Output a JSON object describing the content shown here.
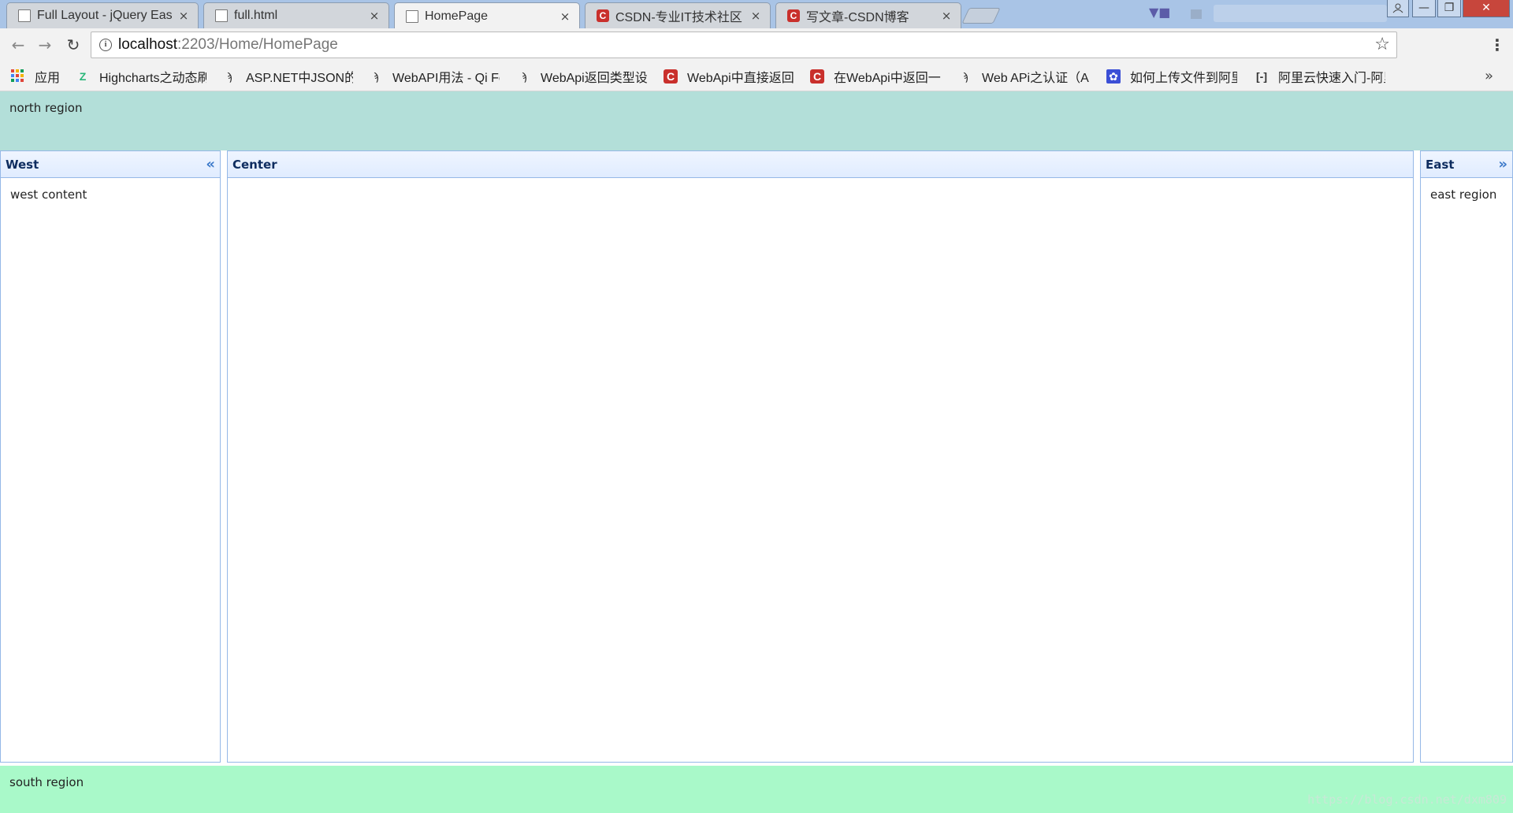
{
  "browser": {
    "tabs": [
      {
        "title": "Full Layout - jQuery Eas",
        "icon": "document-icon",
        "close": "×"
      },
      {
        "title": "full.html",
        "icon": "document-icon",
        "close": "×"
      },
      {
        "title": "HomePage",
        "icon": "document-icon",
        "close": "×"
      },
      {
        "title": "CSDN-专业IT技术社区",
        "icon": "csdn-icon",
        "close": "×"
      },
      {
        "title": "写文章-CSDN博客",
        "icon": "csdn-icon",
        "close": "×"
      }
    ],
    "window_controls": {
      "minimize": "—",
      "restore": "❐",
      "close": "✕"
    },
    "nav": {
      "back": "←",
      "forward": "→",
      "reload": "↻"
    },
    "address": {
      "host": "localhost",
      "path": ":2203/Home/HomePage",
      "info": "i",
      "star": "☆"
    },
    "menu": "⋮",
    "bookmarks": [
      {
        "label": "应用",
        "icon": "apps-icon"
      },
      {
        "label": "Highcharts之动态刷",
        "icon": "highcharts-icon"
      },
      {
        "label": "ASP.NET中JSON的序",
        "icon": "cnblogs-icon"
      },
      {
        "label": "WebAPI用法 - Qi Fe",
        "icon": "cnblogs-icon"
      },
      {
        "label": "WebApi返回类型设",
        "icon": "cnblogs-icon"
      },
      {
        "label": "WebApi中直接返回",
        "icon": "csdn-icon"
      },
      {
        "label": "在WebApi中返回一",
        "icon": "csdn-icon"
      },
      {
        "label": "Web APi之认证（Au",
        "icon": "cnblogs-icon"
      },
      {
        "label": "如何上传文件到阿里",
        "icon": "baidu-icon"
      },
      {
        "label": "阿里云快速入门-阿里",
        "icon": "aliyun-icon"
      }
    ],
    "bookmarks_more": "»",
    "accent": "#a9c4e6"
  },
  "layout": {
    "north": {
      "text": "north region",
      "color": "#b3dfd9"
    },
    "west": {
      "title": "West",
      "content": "west content",
      "collapse": "«"
    },
    "center": {
      "title": "Center"
    },
    "east": {
      "title": "East",
      "content": "east region",
      "collapse": "»"
    },
    "south": {
      "text": "south region",
      "color": "#a9f9c9"
    },
    "panel_border": "#95b8e7"
  },
  "watermark": "https://blog.csdn.net/dxm809"
}
